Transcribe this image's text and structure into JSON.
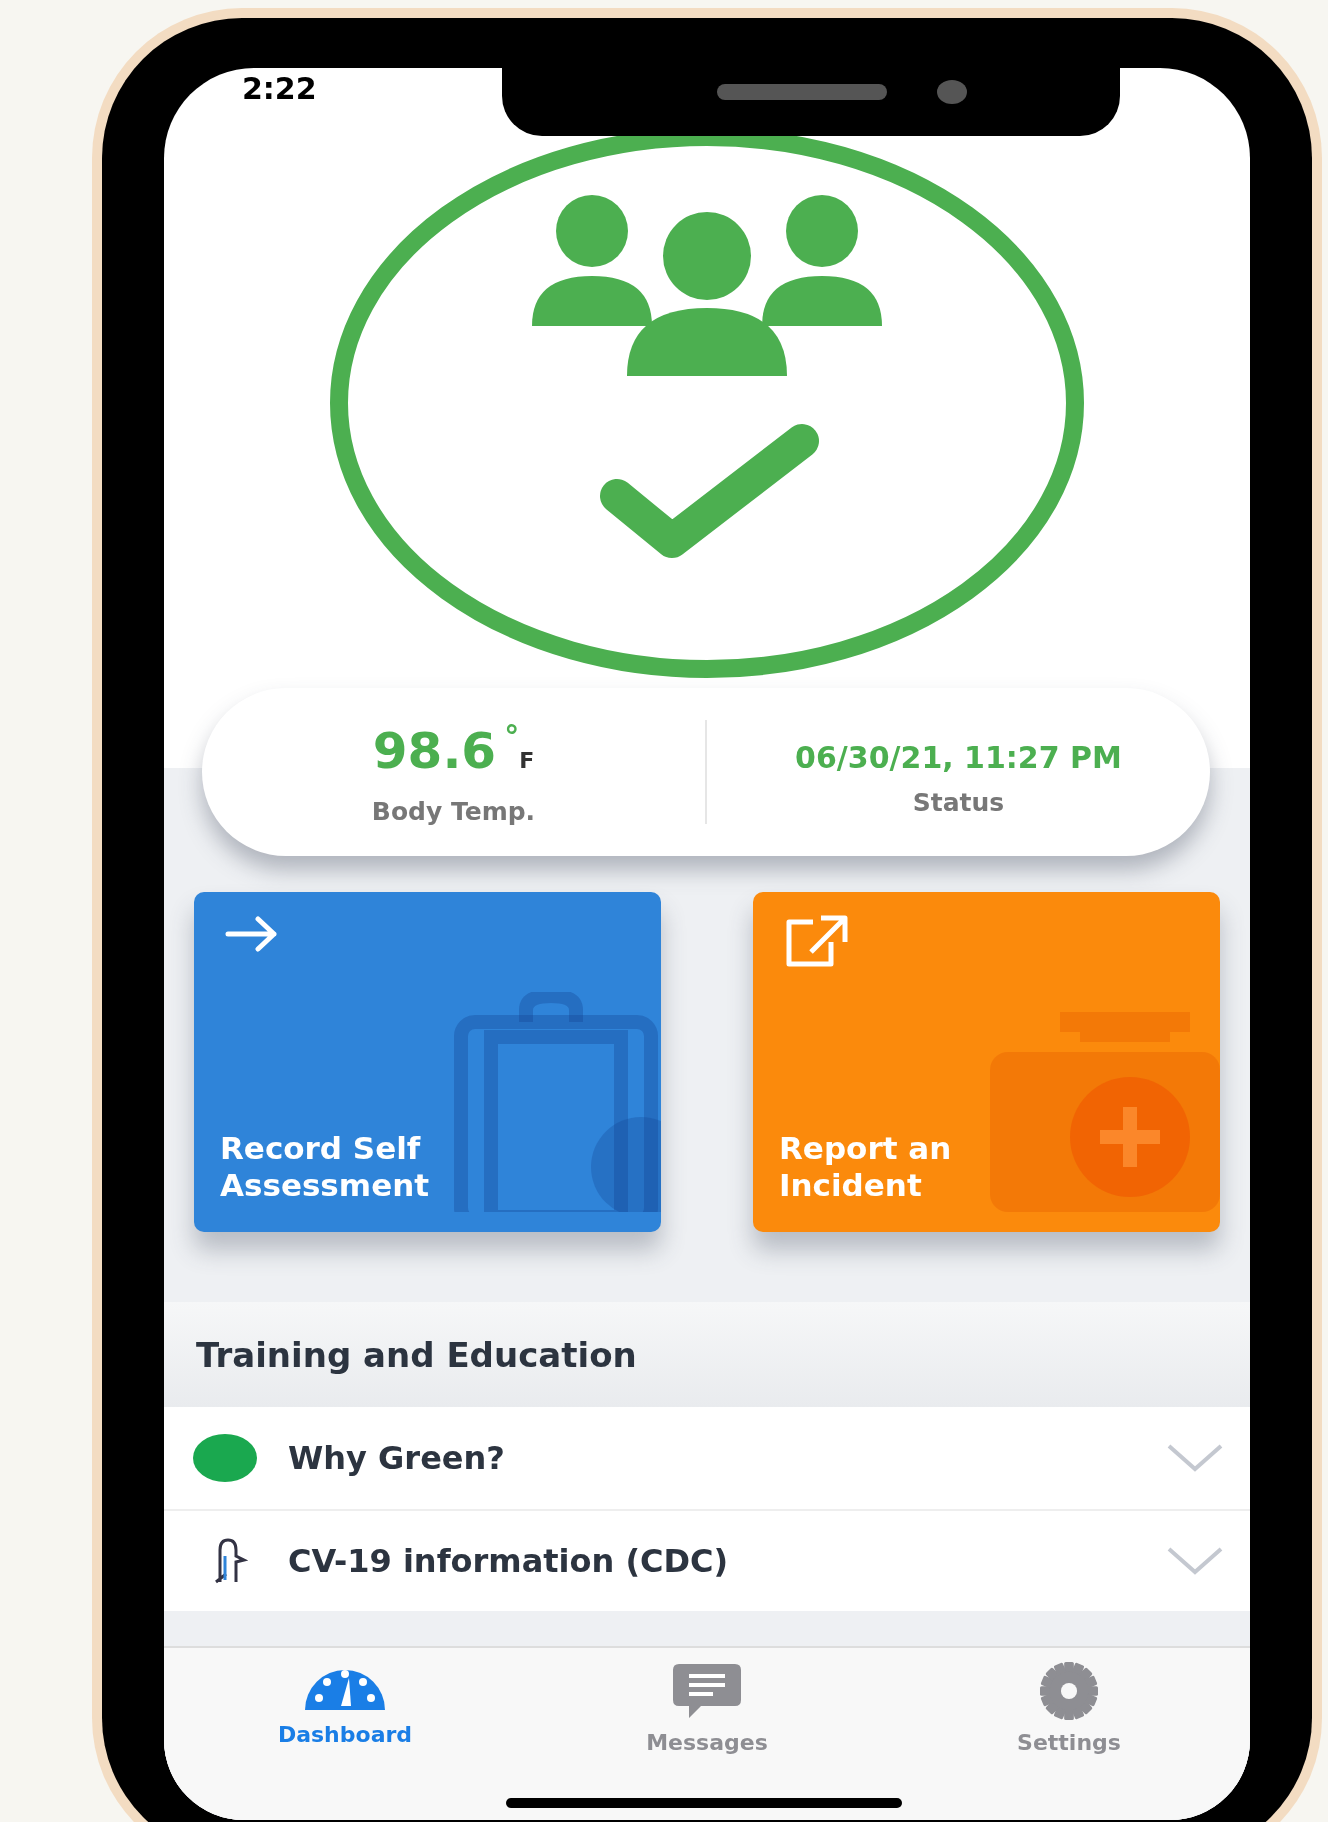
{
  "status_bar": {
    "time": "2:22"
  },
  "vitals": [
    {
      "value": "98.6",
      "degree": "°",
      "unit": "F",
      "label": "Body Temp."
    },
    {
      "value": "06/30/21, 11:27 PM",
      "label": "Status"
    }
  ],
  "actions": [
    {
      "label": "Record Self Assessment",
      "kind": "assessment",
      "color": "#2f84d9"
    },
    {
      "label": "Report an Incident",
      "kind": "incident",
      "color": "#fb8a0c"
    }
  ],
  "section": {
    "title": "Training and Education"
  },
  "items": [
    {
      "label": "Why Green?",
      "kind": "dot",
      "expanded": false
    },
    {
      "label": "CV-19 information (CDC)",
      "kind": "thermometer",
      "expanded": false
    }
  ],
  "tabs": [
    {
      "label": "Dashboard",
      "kind": "dashboard",
      "selected": true
    },
    {
      "label": "Messages",
      "kind": "messages",
      "selected": false
    },
    {
      "label": "Settings",
      "kind": "settings",
      "selected": false
    }
  ]
}
